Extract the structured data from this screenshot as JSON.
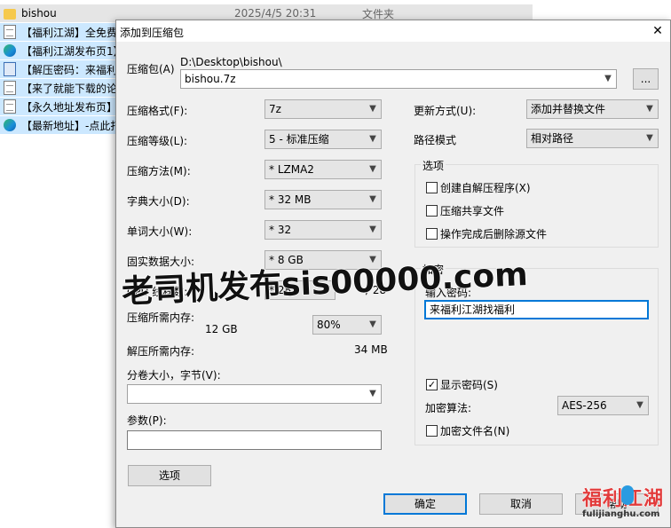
{
  "explorer": {
    "header": {
      "name": "bishou",
      "date": "2025/4/5 20:31",
      "type": "文件夹"
    },
    "files": [
      {
        "name": "【福利江湖】全免费",
        "icon": "document-icon"
      },
      {
        "name": "【福利江湖发布页1】",
        "icon": "edge-browser-icon"
      },
      {
        "name": "【解压密码：来福利",
        "icon": "app-file-icon"
      },
      {
        "name": "【来了就能下载的论",
        "icon": "document-icon"
      },
      {
        "name": "【永久地址发布页】",
        "icon": "edge-browser-icon"
      },
      {
        "name": "【最新地址】-点此打",
        "icon": "edge-browser-icon"
      }
    ]
  },
  "dialog": {
    "title": "添加到压缩包",
    "close_label": "✕",
    "archive": {
      "label": "压缩包(A)",
      "path": "D:\\Desktop\\bishou\\",
      "filename": "bishou.7z",
      "browse_label": "..."
    },
    "left_fields": [
      {
        "label": "压缩格式(F):",
        "value": "7z"
      },
      {
        "label": "压缩等级(L):",
        "value": "5 - 标准压缩"
      },
      {
        "label": "压缩方法(M):",
        "value": "*  LZMA2"
      },
      {
        "label": "字典大小(D):",
        "value": "*  32 MB"
      },
      {
        "label": "单词大小(W):",
        "value": "*  32"
      },
      {
        "label": "固实数据大小:",
        "value": "*  8 GB"
      }
    ],
    "cpu": {
      "label": "CPU 线程数:",
      "value": "*  28",
      "total": "/ 28"
    },
    "memory_compress": {
      "label": "压缩所需内存:",
      "value": "12 GB",
      "percent": "80%"
    },
    "memory_decompress": {
      "label": "解压所需内存:",
      "value": "34 MB"
    },
    "split": {
      "label": "分卷大小，字节(V):",
      "value": ""
    },
    "params": {
      "label": "参数(P):",
      "value": ""
    },
    "options_button": "选项",
    "update_mode": {
      "label": "更新方式(U):",
      "value": "添加并替换文件"
    },
    "path_mode": {
      "label": "路径模式",
      "value": "相对路径"
    },
    "options_group": {
      "title": "选项",
      "checkboxes": [
        {
          "label": "创建自解压程序(X)",
          "checked": false
        },
        {
          "label": "压缩共享文件",
          "checked": false
        },
        {
          "label": "操作完成后删除源文件",
          "checked": false
        }
      ]
    },
    "encryption_group": {
      "title": "加密",
      "password_label": "输入密码:",
      "password_value": "来福利江湖找福利",
      "show_password": {
        "label": "显示密码(S)",
        "checked": true,
        "mark": "✓"
      },
      "method_label": "加密算法:",
      "method_value": "AES-256",
      "encrypt_names": {
        "label": "加密文件名(N)",
        "checked": false
      }
    },
    "ok_button": "确定",
    "cancel_button": "取消",
    "help_button": "帮助"
  },
  "watermark": {
    "text": "老司机发布sis00000.com",
    "logo_cn": "福利江湖",
    "logo_url": "fulijianghu.com"
  },
  "colors": {
    "selection": "#cce8ff",
    "default_button_border": "#0078d7",
    "dialog_bg": "#f0f0f0",
    "logo_red": "#e23b3b"
  }
}
